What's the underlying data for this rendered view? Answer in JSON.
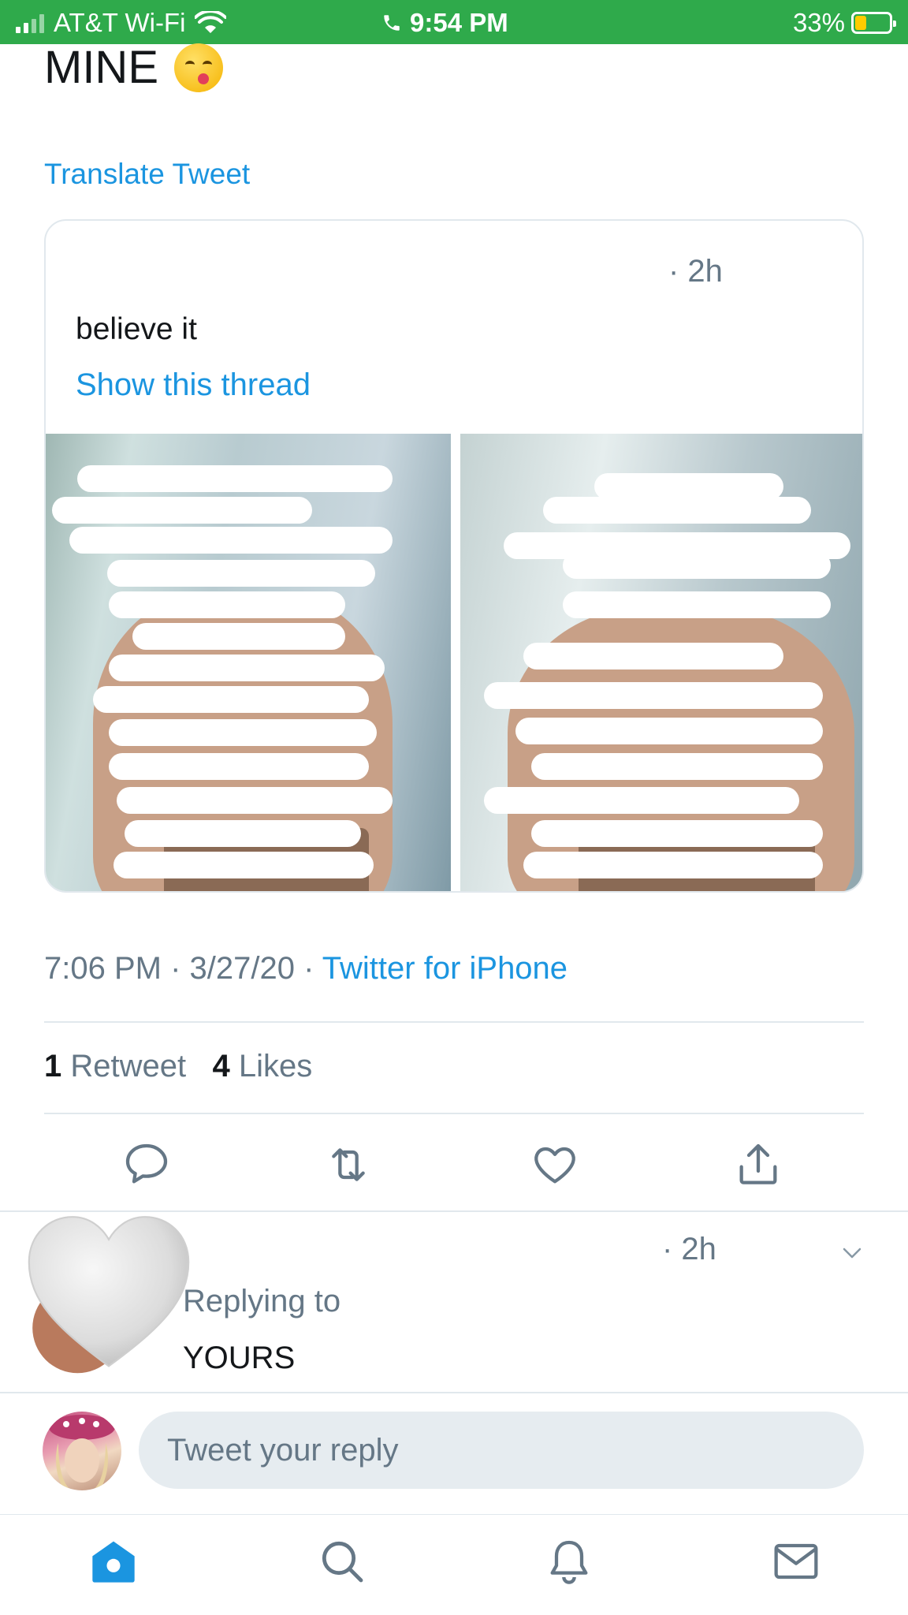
{
  "status_bar": {
    "carrier": "AT&T Wi-Fi",
    "time": "9:54 PM",
    "battery": "33%",
    "battery_level": 0.33
  },
  "tweet": {
    "text": "MINE",
    "emoji": "yum-face-emoji",
    "translate": "Translate Tweet",
    "timestamp": "7:06 PM · 3/27/20 ·",
    "source": "Twitter for iPhone",
    "retweets_count": "1",
    "retweets_label": "Retweet",
    "likes_count": "4",
    "likes_label": "Likes"
  },
  "quoted_tweet": {
    "time": "· 2h",
    "text": "believe it",
    "show_thread": "Show this thread"
  },
  "actions": [
    "reply-icon",
    "retweet-icon",
    "like-icon",
    "share-icon"
  ],
  "reply": {
    "time": "· 2h",
    "replying_label": "Replying to",
    "replying_to": "YOURS"
  },
  "composer": {
    "placeholder": "Tweet your reply"
  },
  "tab_bar": [
    "home-icon",
    "search-icon",
    "notifications-icon",
    "messages-icon"
  ],
  "colors": {
    "status_bar": "#2faa4b",
    "link": "#1b95e0",
    "secondary_text": "#657786",
    "divider": "#e1e8ed"
  }
}
